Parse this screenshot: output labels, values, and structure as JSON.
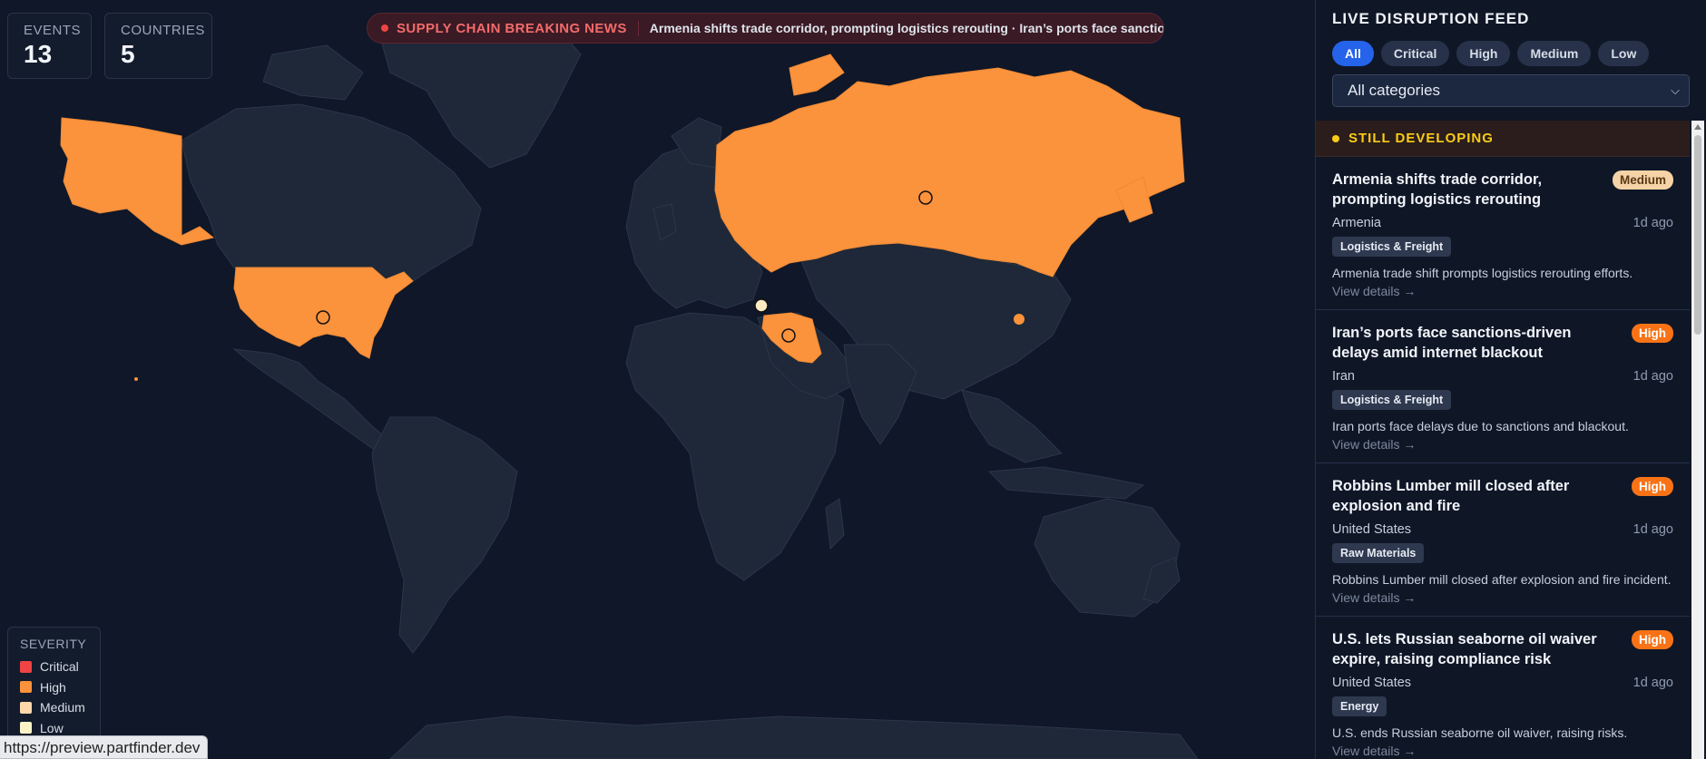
{
  "stats": {
    "events_label": "EVENTS",
    "events_value": "13",
    "countries_label": "COUNTRIES",
    "countries_value": "5"
  },
  "ticker": {
    "label": "SUPPLY CHAIN BREAKING NEWS",
    "text": "Armenia shifts trade corridor, prompting logistics rerouting · Iran’s ports face sanctions-driven delays amid internet blackout · Robbins Lumber mill closed after explosion and fire"
  },
  "legend": {
    "title": "SEVERITY",
    "items": [
      {
        "label": "Critical",
        "color": "#ef4444"
      },
      {
        "label": "High",
        "color": "#fb923c"
      },
      {
        "label": "Medium",
        "color": "#fed7aa"
      },
      {
        "label": "Low",
        "color": "#fef3c7"
      }
    ]
  },
  "map": {
    "land_color": "#1e2838",
    "highlight_color": "#fb923c",
    "highlighted_countries": [
      "United States",
      "Russia",
      "Iran",
      "Armenia"
    ]
  },
  "status_url": "https://preview.partfinder.dev",
  "sidebar": {
    "title": "LIVE DISRUPTION FEED",
    "filters": [
      "All",
      "Critical",
      "High",
      "Medium",
      "Low"
    ],
    "active_filter": "All",
    "category_select": "All categories",
    "developing_label": "STILL DEVELOPING",
    "items": [
      {
        "title": "Armenia shifts trade corridor, prompting logistics rerouting",
        "severity": "Medium",
        "country": "Armenia",
        "time": "1d ago",
        "tag": "Logistics & Freight",
        "desc": "Armenia trade shift prompts logistics rerouting efforts.",
        "link": "View details →"
      },
      {
        "title": "Iran’s ports face sanctions-driven delays amid internet blackout",
        "severity": "High",
        "country": "Iran",
        "time": "1d ago",
        "tag": "Logistics & Freight",
        "desc": "Iran ports face delays due to sanctions and blackout.",
        "link": "View details →"
      },
      {
        "title": "Robbins Lumber mill closed after explosion and fire",
        "severity": "High",
        "country": "United States",
        "time": "1d ago",
        "tag": "Raw Materials",
        "desc": "Robbins Lumber mill closed after explosion and fire incident.",
        "link": "View details →"
      },
      {
        "title": "U.S. lets Russian seaborne oil waiver expire, raising compliance risk",
        "severity": "High",
        "country": "United States",
        "time": "1d ago",
        "tag": "Energy",
        "desc": "U.S. ends Russian seaborne oil waiver, raising risks.",
        "link": "View details →"
      }
    ]
  }
}
